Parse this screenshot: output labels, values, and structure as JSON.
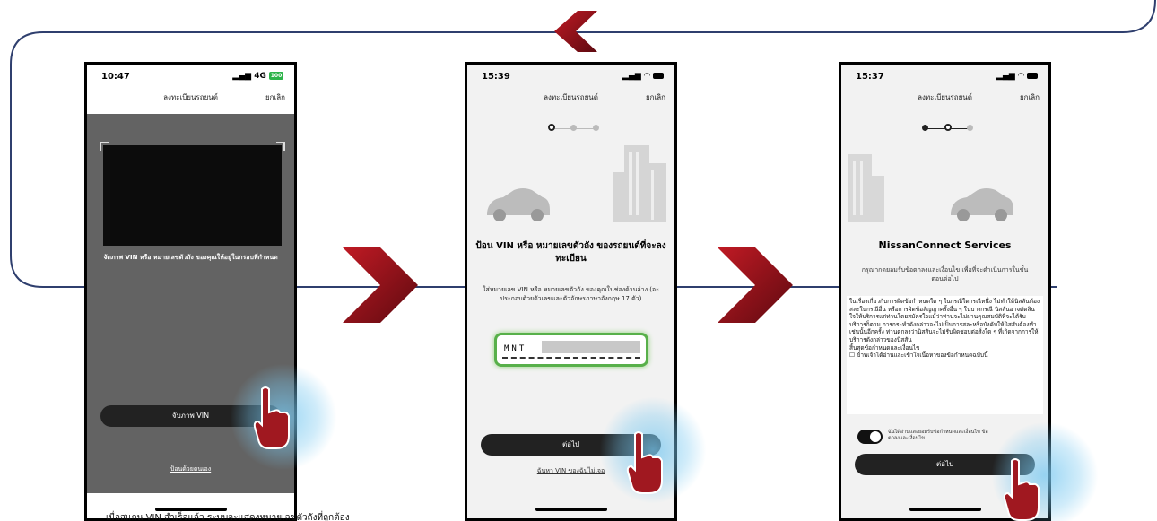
{
  "phone1": {
    "time": "10:47",
    "signal": "4G",
    "battery": "100",
    "title": "ลงทะเบียนรถยนต์",
    "cancel": "ยกเลิก",
    "instruction": "จัดภาพ VIN หรือ หมายเลขตัวถัง ของคุณให้อยู่ในกรอบที่กำหนด",
    "capture_button": "จับภาพ VIN",
    "manual_link": "ป้อนด้วยตนเอง"
  },
  "phone2": {
    "time": "15:39",
    "title": "ลงทะเบียนรถยนต์",
    "cancel": "ยกเลิก",
    "heading": "ป้อน VIN หรือ หมายเลขตัวถัง ของรถยนต์ที่จะลงทะเบียน",
    "body": "ใส่หมายเลข VIN หรือ หมายเลขตัวถัง ของคุณในช่องด้านล่าง (จะประกอบด้วยตัวเลขและตัวอักษรภาษาอังกฤษ 17 ตัว)",
    "vin_value": "MNT",
    "next_button": "ต่อไป",
    "find_vin_link": "ฉันหา VIN ของฉันไม่เจอ"
  },
  "phone3": {
    "time": "15:37",
    "title": "ลงทะเบียนรถยนต์",
    "cancel": "ยกเลิก",
    "heading": "NissanConnect Services",
    "subheading": "กรุณากดยอมรับข้อตกลงและเงื่อนไข เพื่อที่จะดำเนินการในขั้นตอนต่อไป",
    "terms_text": "ในเรื่องเกี่ยวกับการผิดข้อกำหนดใด ๆ ในกรณีใดกรณีหนึ่ง ไม่ทำให้นิสสันต้องสละในกรณีอื่น หรือการผิดข้อสัญญาครั้งอื่น ๆ ในบางกรณี นิสสันอาจตัดสินใจให้บริการแก่ท่านโดยสมัครใจแม้ว่าท่านจะไม่ผ่านคุณสมบัติที่จะได้รับบริการก็ตาม การกระทำดังกล่าวจะไม่เป็นการสละหรือบังคับให้นิสสันต้องทำเช่นนั้นอีกครั้ง ท่านตกลงว่านิสสันจะไม่รับผิดชอบต่อสิ่งใด ๆ ที่เกิดจากการให้บริการดังกล่าวของนิสสัน",
    "terms_end": "สิ้นสุดข้อกำหนดและเงื่อนไข",
    "terms_ack": "☐ ข้าพเจ้าได้อ่านและเข้าใจเนื้อหาของข้อกำหนดฉบับนี้",
    "toggle_label": "ฉันได้อ่านและยอมรับข้อกำหนดและเงื่อนไข ข้อตกลงและเงื่อนไข",
    "next_button": "ต่อไป"
  },
  "caption": "เมื่อสแกน VIN สำเร็จแล้ว ระบบจะแสดงหมายเลขตัวถังที่ถูกต้อง",
  "colors": {
    "accent": "#8a1018",
    "flow_line": "#2f3f6e",
    "glow": "#7cc8f0"
  },
  "icons": [
    "chevron-left-icon",
    "chevron-right-icon",
    "hand-pointer-icon",
    "car-icon",
    "building-icon",
    "signal-icon",
    "wifi-icon",
    "battery-icon"
  ]
}
